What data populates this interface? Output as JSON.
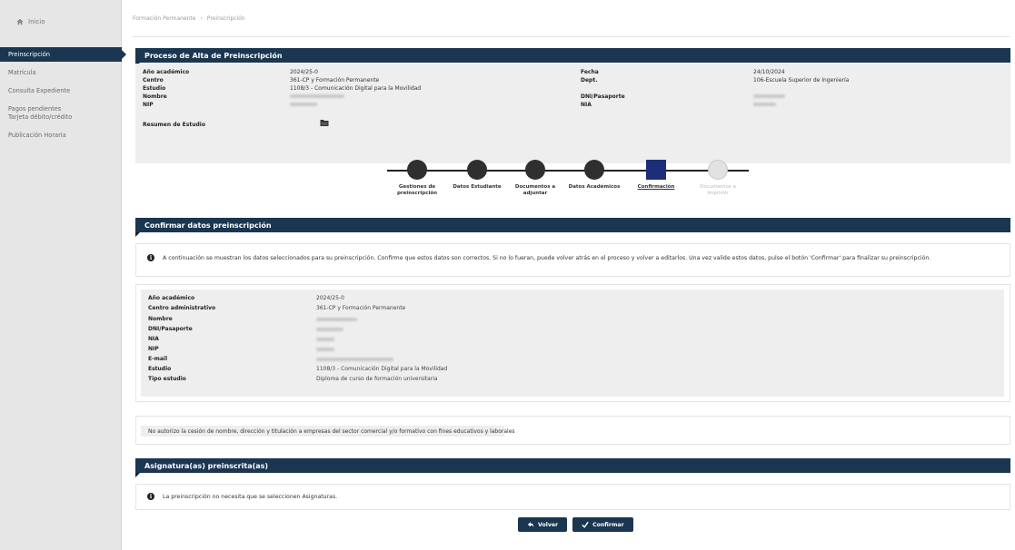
{
  "sidebar": {
    "home_label": "Inicio",
    "items": [
      {
        "label": "Preinscripción"
      },
      {
        "label": "Matrícula"
      },
      {
        "label": "Consulta Expediente"
      },
      {
        "label": "Pagos pendientes Tarjeta débito/crédito"
      },
      {
        "label": "Publicación Horaria"
      }
    ]
  },
  "breadcrumb": [
    "Formación Permanente",
    "Preinscripción"
  ],
  "header": {
    "title": "Proceso de Alta de Preinscripción",
    "fields_left": [
      {
        "label": "Año académico",
        "value": "2024/25-0"
      },
      {
        "label": "Centro",
        "value": "361-CP y Formación Permanente"
      },
      {
        "label": "Estudio",
        "value": "1108/3 - Comunicación Digital para la Movilidad"
      },
      {
        "label": "Nombre",
        "value": ""
      },
      {
        "label": "NIP",
        "value": ""
      }
    ],
    "fields_right": [
      {
        "label": "Fecha",
        "value": "24/10/2024"
      },
      {
        "label": "Dept.",
        "value": "106-Escuela Superior de Ingeniería"
      },
      {
        "label": "DNI/Pasaporte",
        "value": ""
      },
      {
        "label": "NIA",
        "value": ""
      }
    ],
    "resumen_label": "Resumen de Estudio"
  },
  "stepper": {
    "steps": [
      {
        "label": "Gestiones de preinscripción",
        "state": "done"
      },
      {
        "label": "Datos Estudiante",
        "state": "done"
      },
      {
        "label": "Documentos a adjuntar",
        "state": "done"
      },
      {
        "label": "Datos Académicos",
        "state": "done"
      },
      {
        "label": "Confirmación",
        "state": "current"
      },
      {
        "label": "Documentos a imprimir",
        "state": "pending"
      }
    ]
  },
  "confirm": {
    "title": "Confirmar datos preinscripción",
    "info": "A continuación se muestran los datos seleccionados para su preinscripción. Confirme que estos datos son correctos. Si no lo fueran, puede volver atrás en el proceso y volver a editarlos. Una vez valide estos datos, pulse el botón 'Confirmar' para finalizar su preinscripción.",
    "rows": [
      {
        "label": "Año académico",
        "value": "2024/25-0"
      },
      {
        "label": "Centro administrativo",
        "value": "361-CP y Formación Permanente"
      },
      {
        "label": "Nombre",
        "value": ""
      },
      {
        "label": "DNI/Pasaporte",
        "value": ""
      },
      {
        "label": "NIA",
        "value": ""
      },
      {
        "label": "NIP",
        "value": ""
      },
      {
        "label": "E-mail",
        "value": ""
      },
      {
        "label": "Estudio",
        "value": "1108/3 - Comunicación Digital para la Movilidad"
      },
      {
        "label": "Tipo estudio",
        "value": "Diploma de curso de formación universitaria"
      }
    ],
    "consent": "No autorizo la cesión de nombre, dirección y titulación a empresas del sector comercial y/o formativo con fines educativos y laborales"
  },
  "subjects": {
    "title": "Asignatura(as) preinscrita(as)",
    "info": "La preinscripción no necesita que se seleccionen Asignaturas."
  },
  "buttons": {
    "back_label": "Volver",
    "confirm_label": "Confirmar"
  }
}
